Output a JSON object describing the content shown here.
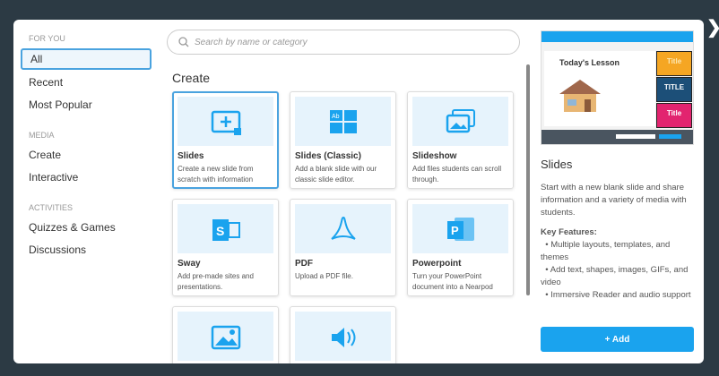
{
  "sidebar": {
    "sections": [
      {
        "title": "FOR YOU",
        "items": [
          "All",
          "Recent",
          "Most Popular"
        ]
      },
      {
        "title": "MEDIA",
        "items": [
          "Create",
          "Interactive"
        ]
      },
      {
        "title": "ACTIVITIES",
        "items": [
          "Quizzes & Games",
          "Discussions"
        ]
      }
    ],
    "active": "All"
  },
  "search": {
    "placeholder": "Search by name or category"
  },
  "section_title": "Create",
  "cards": [
    {
      "title": "Slides",
      "desc": "Create a new slide from scratch with information",
      "icon": "slide-add-icon"
    },
    {
      "title": "Slides (Classic)",
      "desc": "Add a blank slide with our classic slide editor.",
      "icon": "classic-slide-grid-icon"
    },
    {
      "title": "Slideshow",
      "desc": "Add files students can scroll through.",
      "icon": "slideshow-icon"
    },
    {
      "title": "Sway",
      "desc": "Add pre-made sites and presentations.",
      "icon": "sway-icon"
    },
    {
      "title": "PDF",
      "desc": "Upload a PDF file.",
      "icon": "pdf-icon"
    },
    {
      "title": "Powerpoint",
      "desc": "Turn your PowerPoint document into a Nearpod",
      "icon": "powerpoint-icon"
    },
    {
      "title": "",
      "desc": "",
      "icon": "image-icon"
    },
    {
      "title": "",
      "desc": "",
      "icon": "audio-icon"
    }
  ],
  "preview": {
    "lesson_title": "Today's Lesson",
    "tiles": [
      "Title",
      "TITLE",
      "Title"
    ]
  },
  "detail": {
    "title": "Slides",
    "description": "Start with a new blank slide and share information and a variety of media with students.",
    "features_label": "Key Features:",
    "features": [
      "Multiple layouts, templates, and themes",
      "Add text, shapes, images, GIFs, and video",
      "Immersive Reader and audio support"
    ],
    "add_label": "+ Add"
  },
  "colors": {
    "accent": "#1aa3ee",
    "selected_border": "#4aa3df"
  }
}
